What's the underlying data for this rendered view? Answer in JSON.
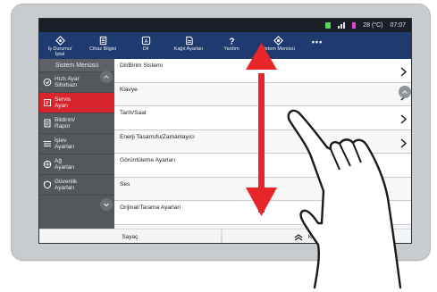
{
  "status": {
    "temperature": "28 (°C)",
    "time": "07:07"
  },
  "toolbar": {
    "items": [
      {
        "label": "İş Durumu/\nİptal",
        "icon": "job-status-icon"
      },
      {
        "label": "Cihaz Bilgisi",
        "icon": "device-info-icon"
      },
      {
        "label": "Dil",
        "icon": "language-icon"
      },
      {
        "label": "Kağıt Ayarları",
        "icon": "paper-settings-icon"
      },
      {
        "label": "Yardım",
        "icon": "help-icon"
      },
      {
        "label": "Sistem Menüsü",
        "icon": "system-menu-icon"
      }
    ],
    "more_label": "•••"
  },
  "sidebar": {
    "title": "Sistem Menüsü",
    "items": [
      {
        "label": "Hızlı Ayar\nSihirbazı",
        "icon": "wizard-icon",
        "active": false
      },
      {
        "label": "Servis\nAyarı",
        "icon": "service-icon",
        "active": true
      },
      {
        "label": "Bildirim/\nRapor",
        "icon": "report-icon",
        "active": false
      },
      {
        "label": "İşlev\nAyarları",
        "icon": "function-icon",
        "active": false
      },
      {
        "label": "Ağ\nAyarları",
        "icon": "network-icon",
        "active": false
      },
      {
        "label": "Güvenlik\nAyarları",
        "icon": "security-icon",
        "active": false
      }
    ]
  },
  "list": {
    "rows": [
      "Dil/Birim Sistemi",
      "Klavye",
      "Tarih/Saat",
      "Enerji Tasarrufu/Zamanlayıcı",
      "Görüntüleme Ayarları",
      "Ses",
      "Orijinal/Tarama Ayarları"
    ]
  },
  "bottombar": {
    "counter_label": "Sayaç",
    "home_label": "Ka"
  },
  "colors": {
    "toolbar": "#1f3a6e",
    "active": "#d6252c",
    "arrow": "#e8262a"
  }
}
